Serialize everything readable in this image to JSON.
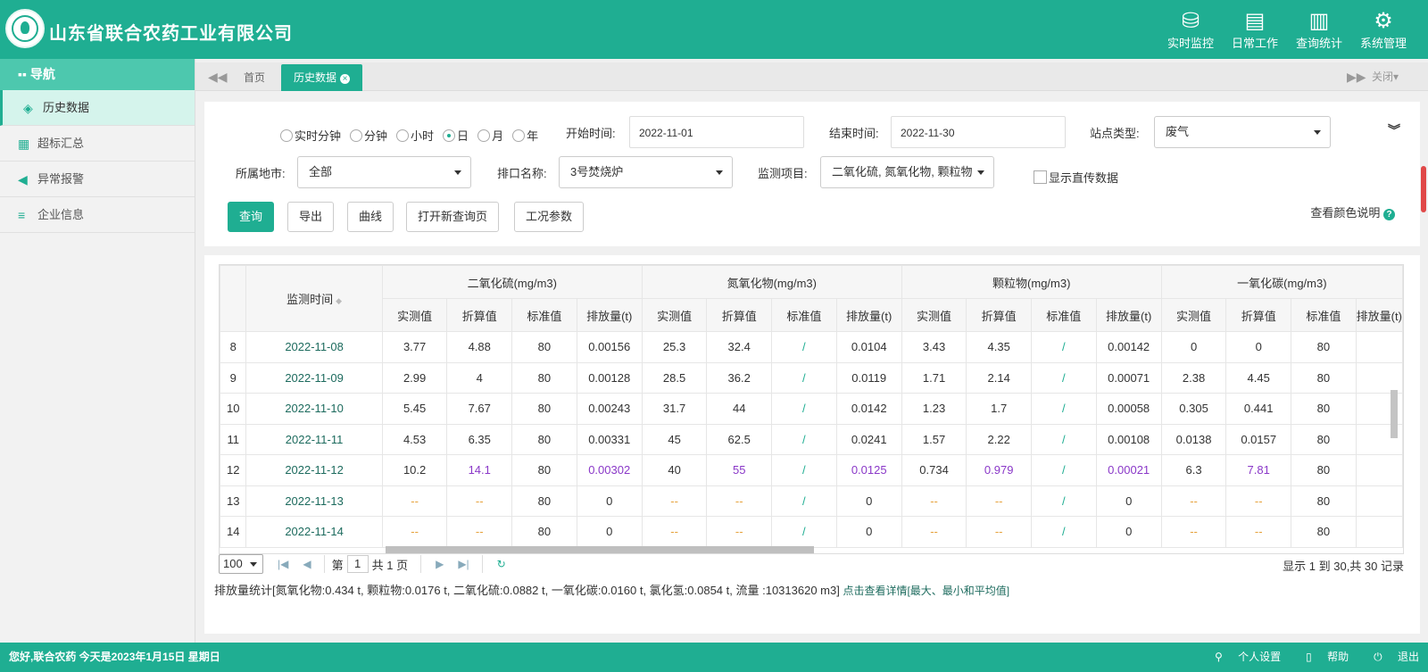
{
  "header": {
    "company": "山东省联合农药工业有限公司",
    "logo_icon": "environment-logo-icon",
    "nav": [
      {
        "label": "实时监控",
        "icon": "database-icon"
      },
      {
        "label": "日常工作",
        "icon": "briefcase-icon"
      },
      {
        "label": "查询统计",
        "icon": "chart-icon"
      },
      {
        "label": "系统管理",
        "icon": "gear-icon"
      }
    ]
  },
  "sidebar": {
    "title": "导航",
    "items": [
      {
        "label": "历史数据",
        "icon": "layers-icon",
        "active": true
      },
      {
        "label": "超标汇总",
        "icon": "clipboard-icon"
      },
      {
        "label": "异常报警",
        "icon": "speaker-icon"
      },
      {
        "label": "企业信息",
        "icon": "list-icon"
      }
    ]
  },
  "tabs": {
    "home": "首页",
    "current": "历史数据",
    "close_label": "关闭"
  },
  "filter": {
    "radios": [
      "实时分钟",
      "分钟",
      "小时",
      "日",
      "月",
      "年"
    ],
    "selected_radio": "日",
    "start_label": "开始时间:",
    "start_value": "2022-11-01",
    "end_label": "结束时间:",
    "end_value": "2022-11-30",
    "station_type_label": "站点类型:",
    "station_type_value": "废气",
    "city_label": "所属地市:",
    "city_value": "全部",
    "outlet_label": "排口名称:",
    "outlet_value": "3号焚烧炉",
    "item_label": "监测项目:",
    "item_value": "二氧化硫, 氮氧化物, 颗粒物",
    "direct_label": "显示直传数据",
    "buttons": [
      "查询",
      "导出",
      "曲线",
      "打开新查询页",
      "工况参数"
    ],
    "color_help": "查看颜色说明"
  },
  "table": {
    "time_header": "监测时间",
    "groups": [
      "二氧化硫(mg/m3)",
      "氮氧化物(mg/m3)",
      "颗粒物(mg/m3)",
      "一氧化碳(mg/m3)"
    ],
    "subcols": [
      "实测值",
      "折算值",
      "标准值",
      "排放量(t)"
    ],
    "rows": [
      {
        "no": "8",
        "date": "2022-11-08",
        "cells": [
          "3.77",
          "4.88",
          "80",
          "0.00156",
          "25.3",
          "32.4",
          "/",
          "0.0104",
          "3.43",
          "4.35",
          "/",
          "0.00142",
          "0",
          "0",
          "80"
        ]
      },
      {
        "no": "9",
        "date": "2022-11-09",
        "cells": [
          "2.99",
          "4",
          "80",
          "0.00128",
          "28.5",
          "36.2",
          "/",
          "0.0119",
          "1.71",
          "2.14",
          "/",
          "0.00071",
          "2.38",
          "4.45",
          "80"
        ]
      },
      {
        "no": "10",
        "date": "2022-11-10",
        "cells": [
          "5.45",
          "7.67",
          "80",
          "0.00243",
          "31.7",
          "44",
          "/",
          "0.0142",
          "1.23",
          "1.7",
          "/",
          "0.00058",
          "0.305",
          "0.441",
          "80"
        ]
      },
      {
        "no": "11",
        "date": "2022-11-11",
        "cells": [
          "4.53",
          "6.35",
          "80",
          "0.00331",
          "45",
          "62.5",
          "/",
          "0.0241",
          "1.57",
          "2.22",
          "/",
          "0.00108",
          "0.0138",
          "0.0157",
          "80"
        ]
      },
      {
        "no": "12",
        "date": "2022-11-12",
        "cells": [
          "10.2",
          "14.1",
          "80",
          "0.00302",
          "40",
          "55",
          "/",
          "0.0125",
          "0.734",
          "0.979",
          "/",
          "0.00021",
          "6.3",
          "7.81",
          "80"
        ],
        "purple": [
          1,
          3,
          5,
          7,
          9,
          11,
          13
        ]
      },
      {
        "no": "13",
        "date": "2022-11-13",
        "cells": [
          "--",
          "--",
          "80",
          "0",
          "--",
          "--",
          "/",
          "0",
          "--",
          "--",
          "/",
          "0",
          "--",
          "--",
          "80"
        ]
      },
      {
        "no": "14",
        "date": "2022-11-14",
        "cells": [
          "--",
          "--",
          "80",
          "0",
          "--",
          "--",
          "/",
          "0",
          "--",
          "--",
          "/",
          "0",
          "--",
          "--",
          "80"
        ]
      }
    ]
  },
  "pager": {
    "page_size": "100",
    "page_prefix": "第",
    "page_value": "1",
    "page_suffix": "共 1 页",
    "info": "显示 1 到 30,共 30 记录"
  },
  "summary": {
    "text": "排放量统计[氮氧化物:0.434 t, 颗粒物:0.0176 t, 二氧化硫:0.0882 t, 一氧化碳:0.0160 t, 氯化氢:0.0854 t, 流量 :10313620 m3]",
    "detail": "点击查看详情[最大、最小和平均值]"
  },
  "footer": {
    "greeting": "您好,联合农药 今天是2023年1月15日 星期日",
    "links": [
      "个人设置",
      "帮助",
      "退出"
    ]
  }
}
